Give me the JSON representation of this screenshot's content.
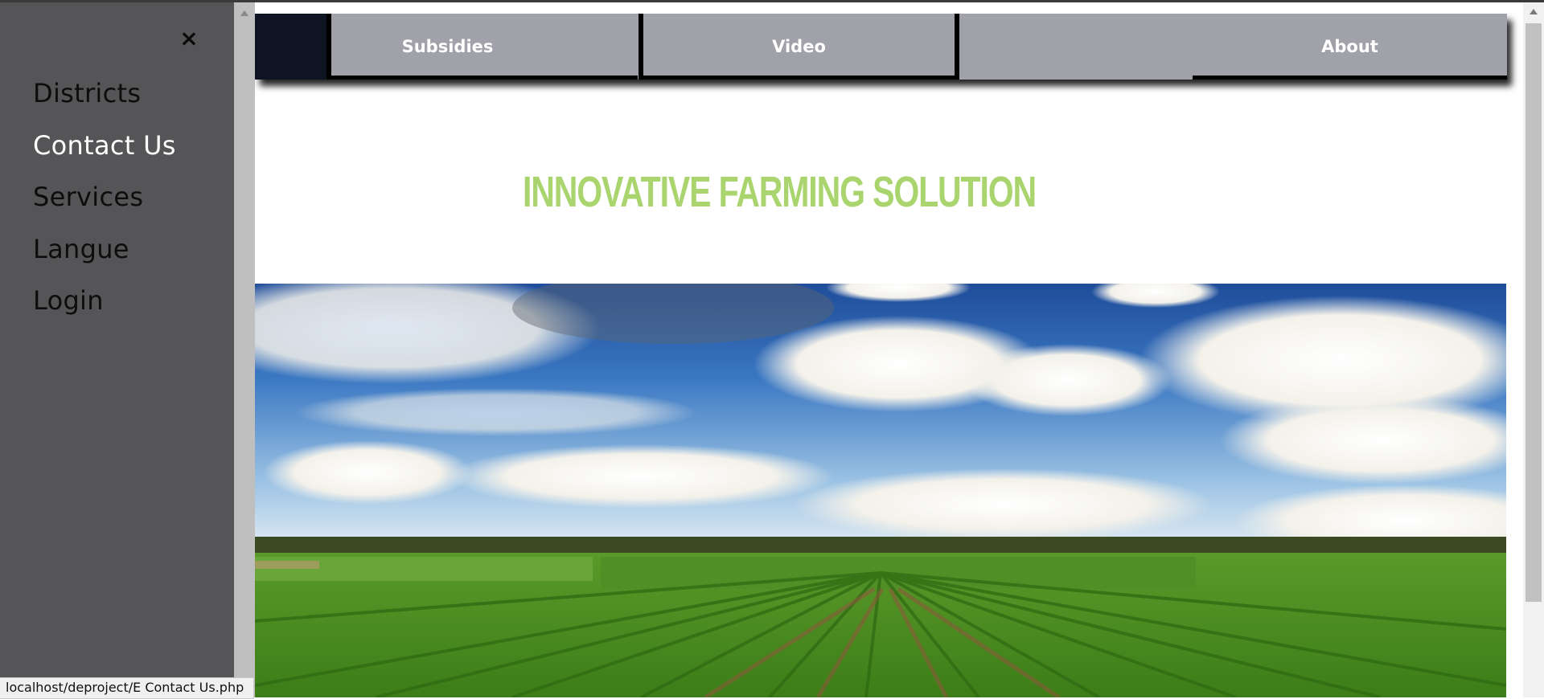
{
  "sidebar": {
    "close_label": "×",
    "items": [
      {
        "label": "Districts",
        "active": false
      },
      {
        "label": "Contact Us",
        "active": true
      },
      {
        "label": "Services",
        "active": false
      },
      {
        "label": "Langue",
        "active": false
      },
      {
        "label": "Login",
        "active": false
      }
    ]
  },
  "navbar": {
    "tabs": [
      {
        "label": "Subsidies"
      },
      {
        "label": "Video"
      },
      {
        "label": ""
      },
      {
        "label": "About"
      }
    ]
  },
  "main": {
    "headline": "INNOVATIVE FARMING SOLUTION",
    "hero_image": "farm-landscape-image"
  },
  "status": {
    "url": "localhost/deproject/E Contact Us.php"
  },
  "colors": {
    "sidebar_bg": "#555558",
    "navbar_bg": "#a1a1aa",
    "headline": "#a9d46e",
    "active_link": "#ffffff"
  }
}
